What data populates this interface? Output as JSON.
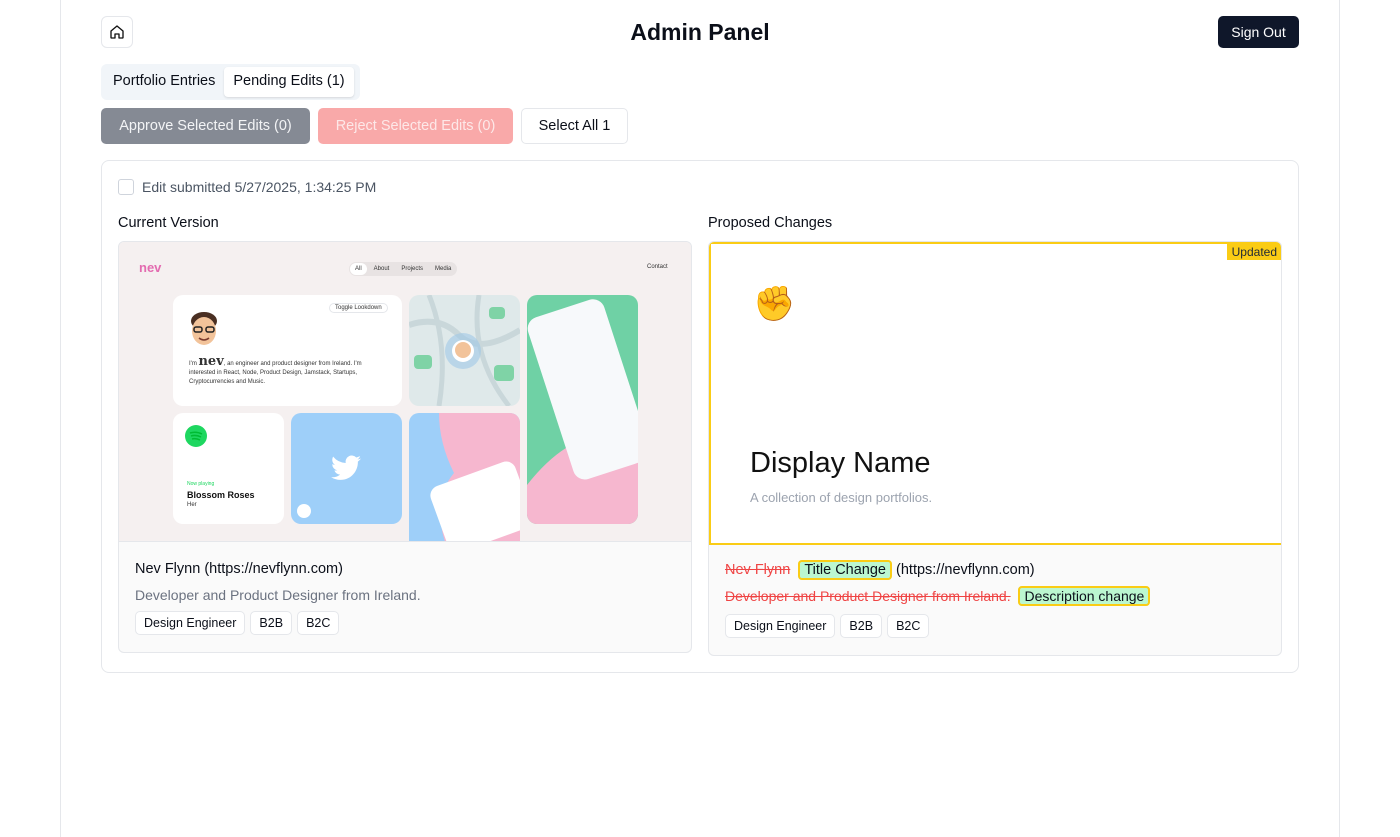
{
  "header": {
    "title": "Admin Panel",
    "sign_out": "Sign Out"
  },
  "tabs": [
    {
      "label": "Portfolio Entries",
      "active": false
    },
    {
      "label": "Pending Edits (1)",
      "active": true
    }
  ],
  "actions": {
    "approve": "Approve Selected Edits (0)",
    "reject": "Reject Selected Edits (0)",
    "select_all": "Select All 1"
  },
  "edit": {
    "submitted": "Edit submitted 5/27/2025, 1:34:25 PM",
    "current": {
      "label": "Current Version",
      "name": "Nev Flynn",
      "url": "(https://nevflynn.com)",
      "description": "Developer and Product Designer from Ireland.",
      "tags": [
        "Design Engineer",
        "B2B",
        "B2C"
      ],
      "preview": {
        "logo": "nev",
        "nav": [
          "All",
          "About",
          "Projects",
          "Media"
        ],
        "contact": "Contact",
        "toggle": "Toggle Lookdown",
        "bio_prefix": "I'm",
        "bio_name": "nev",
        "bio_rest": ", an engineer and product designer from Ireland. I'm interested in React, Node, Product Design, Jamstack, Startups, Cryptocurrencies and Music.",
        "now_playing": "Now playing",
        "song": "Blossom Roses",
        "artist": "Her"
      }
    },
    "proposed": {
      "label": "Proposed Changes",
      "badge": "Updated",
      "emoji": "✊",
      "display_name": "Display Name",
      "tagline": "A collection of design portfolios.",
      "old_name": "Nev Flynn",
      "new_name": "Title Change",
      "url": "(https://nevflynn.com)",
      "old_description": "Developer and Product Designer from Ireland.",
      "new_description": "Description change",
      "tags": [
        "Design Engineer",
        "B2B",
        "B2C"
      ]
    }
  },
  "colors": {
    "primary": "#0f172a",
    "highlight": "#facc15",
    "added": "#bbf7d0",
    "removed": "#ef4444"
  }
}
